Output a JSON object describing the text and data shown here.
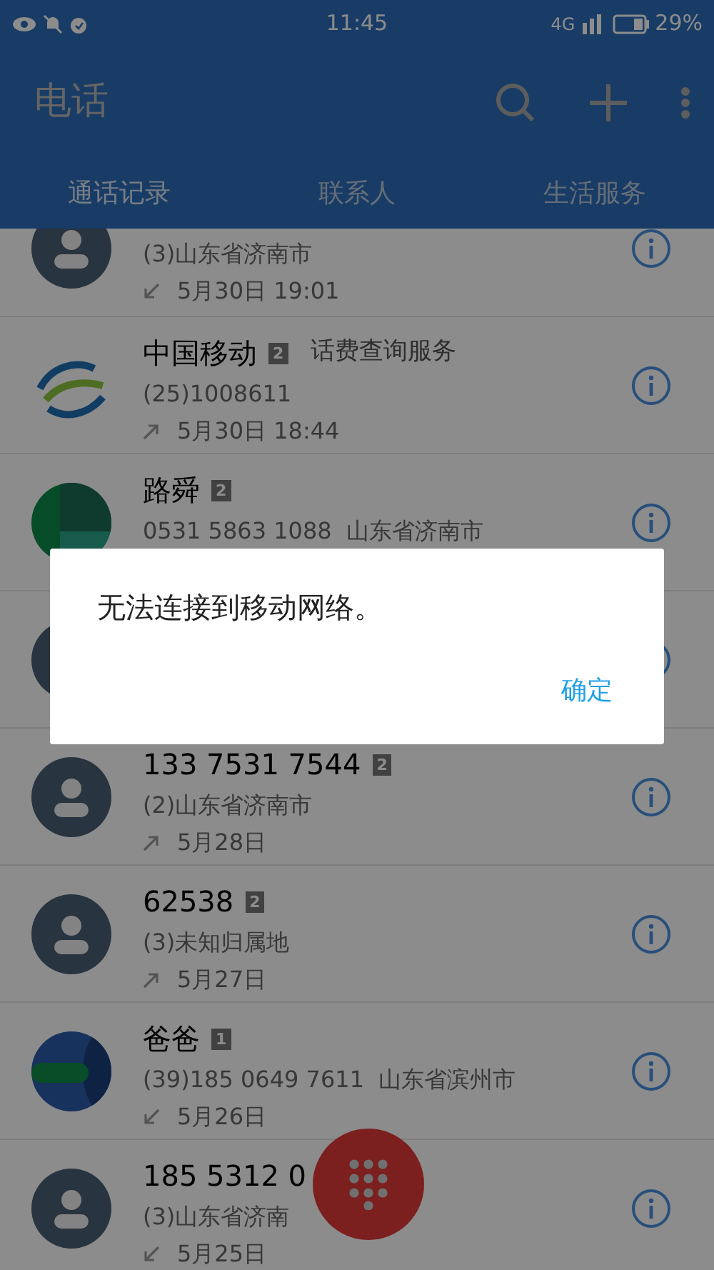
{
  "status_bar": {
    "time": "11:45",
    "network": "4G",
    "battery_text": "29%"
  },
  "app_bar": {
    "title": "电话"
  },
  "tabs": [
    {
      "label": "通话记录",
      "selected": true
    },
    {
      "label": "联系人",
      "selected": false
    },
    {
      "label": "生活服务",
      "selected": false
    }
  ],
  "calls": [
    {
      "kind": "person",
      "detail": "(3)山东省济南市",
      "incoming": true,
      "time": "5月30日 19:01"
    },
    {
      "kind": "logo",
      "name": "中国移动",
      "sim": "2",
      "tag": "话费查询服务",
      "detail": "(25)1008611",
      "incoming": false,
      "time": "5月30日 18:44"
    },
    {
      "kind": "green",
      "name": "路舜",
      "sim": "2",
      "detail": "0531 5863 1088  山东省济南市"
    },
    {
      "kind": "person"
    },
    {
      "kind": "person",
      "name": "133 7531 7544",
      "sim": "2",
      "detail": "(2)山东省济南市",
      "incoming": false,
      "time": "5月28日"
    },
    {
      "kind": "person",
      "name": "62538",
      "sim": "2",
      "detail": "(3)未知归属地",
      "incoming": false,
      "time": "5月27日"
    },
    {
      "kind": "blue",
      "name": "爸爸",
      "sim": "1",
      "detail": "(39)185 0649 7611  山东省滨州市",
      "incoming": true,
      "time": "5月26日"
    },
    {
      "kind": "person",
      "name": "185 5312 0",
      "detail": "(3)山东省济南",
      "incoming": true,
      "time": "5月25日"
    }
  ],
  "dialog": {
    "message": "无法连接到移动网络。",
    "button": "确定"
  }
}
